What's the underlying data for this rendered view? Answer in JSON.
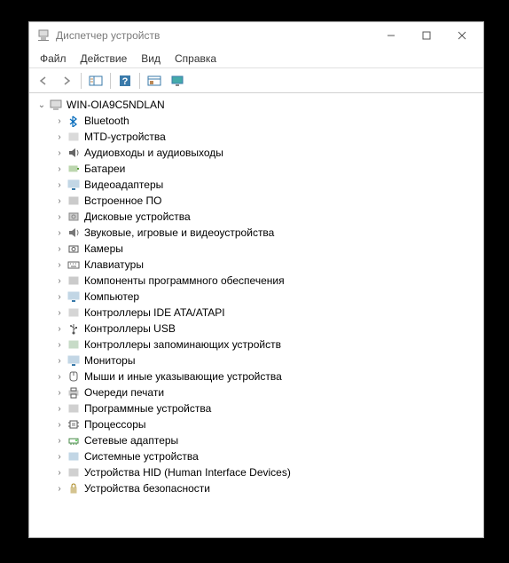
{
  "window": {
    "title": "Диспетчер устройств"
  },
  "menubar": {
    "file": "Файл",
    "action": "Действие",
    "view": "Вид",
    "help": "Справка"
  },
  "tree": {
    "root": "WIN-OIA9C5NDLAN",
    "items": [
      {
        "label": "Bluetooth",
        "icon": "bluetooth"
      },
      {
        "label": "MTD-устройства",
        "icon": "mtd"
      },
      {
        "label": "Аудиовходы и аудиовыходы",
        "icon": "audio"
      },
      {
        "label": "Батареи",
        "icon": "battery"
      },
      {
        "label": "Видеоадаптеры",
        "icon": "display-adapter"
      },
      {
        "label": "Встроенное ПО",
        "icon": "firmware"
      },
      {
        "label": "Дисковые устройства",
        "icon": "disk"
      },
      {
        "label": "Звуковые, игровые и видеоустройства",
        "icon": "sound"
      },
      {
        "label": "Камеры",
        "icon": "camera"
      },
      {
        "label": "Клавиатуры",
        "icon": "keyboard"
      },
      {
        "label": "Компоненты программного обеспечения",
        "icon": "software"
      },
      {
        "label": "Компьютер",
        "icon": "computer"
      },
      {
        "label": "Контроллеры IDE ATA/ATAPI",
        "icon": "ide"
      },
      {
        "label": "Контроллеры USB",
        "icon": "usb"
      },
      {
        "label": "Контроллеры запоминающих устройств",
        "icon": "storage"
      },
      {
        "label": "Мониторы",
        "icon": "monitor"
      },
      {
        "label": "Мыши и иные указывающие устройства",
        "icon": "mouse"
      },
      {
        "label": "Очереди печати",
        "icon": "printer"
      },
      {
        "label": "Программные устройства",
        "icon": "software-dev"
      },
      {
        "label": "Процессоры",
        "icon": "cpu"
      },
      {
        "label": "Сетевые адаптеры",
        "icon": "network"
      },
      {
        "label": "Системные устройства",
        "icon": "system"
      },
      {
        "label": "Устройства HID (Human Interface Devices)",
        "icon": "hid"
      },
      {
        "label": "Устройства безопасности",
        "icon": "security"
      }
    ]
  },
  "icons": {
    "bluetooth": "#0a6ebd",
    "mtd": "#888888",
    "audio": "#666666",
    "battery": "#5a9a3a",
    "display-adapter": "#3a7aaa",
    "firmware": "#555555",
    "disk": "#888888",
    "sound": "#777777",
    "camera": "#555555",
    "keyboard": "#666666",
    "software": "#555555",
    "computer": "#3a7aaa",
    "ide": "#777777",
    "usb": "#555555",
    "storage": "#4a8a4a",
    "monitor": "#3a7aaa",
    "mouse": "#666666",
    "printer": "#555555",
    "software-dev": "#666666",
    "cpu": "#555555",
    "network": "#4a8a4a",
    "system": "#3a7aaa",
    "hid": "#666666",
    "security": "#aa8822"
  }
}
